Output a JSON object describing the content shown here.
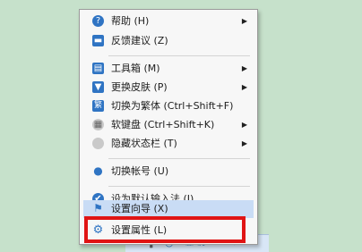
{
  "menu": {
    "items": [
      {
        "label": "帮助 (H)",
        "icon": "help-icon",
        "has_submenu": true
      },
      {
        "label": "反馈建议 (Z)",
        "icon": "feedback-icon",
        "has_submenu": false
      },
      {
        "label": "工具箱 (M)",
        "icon": "toolbox-icon",
        "has_submenu": true
      },
      {
        "label": "更换皮肤 (P)",
        "icon": "skin-icon",
        "has_submenu": true
      },
      {
        "label": "切换为繁体 (Ctrl+Shift+F)",
        "icon": "traditional-chinese-icon",
        "has_submenu": false
      },
      {
        "label": "软键盘 (Ctrl+Shift+K)",
        "icon": "soft-keyboard-icon",
        "has_submenu": true
      },
      {
        "label": "隐藏状态栏 (T)",
        "icon": "hide-statusbar-icon",
        "has_submenu": true
      },
      {
        "label": "切换帐号 (U)",
        "icon": "switch-account-icon",
        "has_submenu": false
      },
      {
        "label": "设为默认输入法 (I)",
        "icon": "default-ime-icon",
        "has_submenu": false
      },
      {
        "label": "设置向导 (X)",
        "icon": "setup-wizard-icon",
        "has_submenu": false
      },
      {
        "label": "设置属性 (L)",
        "icon": "settings-icon",
        "has_submenu": false
      }
    ],
    "highlighted_item": "设置属性 (L)",
    "highlight_color": "#e01414"
  },
  "glyphs": {
    "submenu_arrow": "▶",
    "help": "?",
    "feedback": "▬",
    "toolbox": "▤",
    "skin": "▼",
    "traditional": "繁",
    "keyboard": "▦",
    "check": "✔",
    "flag": "⚑",
    "gear": "⚙",
    "user": "●"
  },
  "taskbar": {
    "text": "输入方"
  }
}
